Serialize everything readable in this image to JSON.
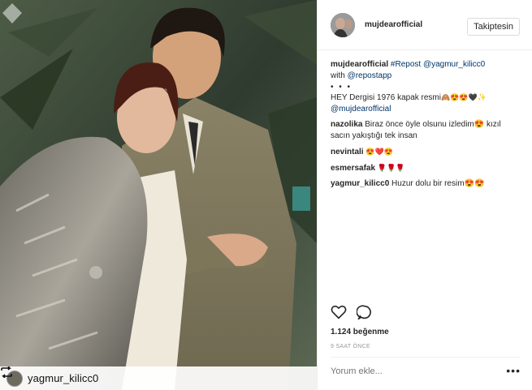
{
  "post": {
    "username": "mujdearofficial",
    "follow_label": "Takiptesin",
    "caption": {
      "user": "mujdearofficial",
      "hashtag": "#Repost",
      "mention": "@yagmur_kilicc0",
      "with_text": "with",
      "app_mention": "@repostapp",
      "dots": "• • •",
      "body": "HEY Dergisi 1976 kapak resmi",
      "body_emoji": "🙈😍😍🖤✨",
      "tag": "@mujdearofficial"
    },
    "comments": [
      {
        "user": "nazolika",
        "text": "Biraz önce öyle olsunu izledim😍 kızıl sacın yakıştığı tek insan"
      },
      {
        "user": "nevintali",
        "text": "😍❤️😍"
      },
      {
        "user": "esmersafak",
        "text": "🌹🌹🌹"
      },
      {
        "user": "yagmur_kilicc0",
        "text": "Huzur dolu bir resim😍😍"
      }
    ],
    "icons": {
      "like": "heart-icon",
      "comment": "comment-icon",
      "repost": "repost-icon",
      "more": "more-icon"
    },
    "likes": "1.124 beğenme",
    "time": "9 SAAT ÖNCE",
    "comment_placeholder": "Yorum ekle...",
    "more": "•••",
    "repost_user": "yagmur_kilicc0"
  }
}
